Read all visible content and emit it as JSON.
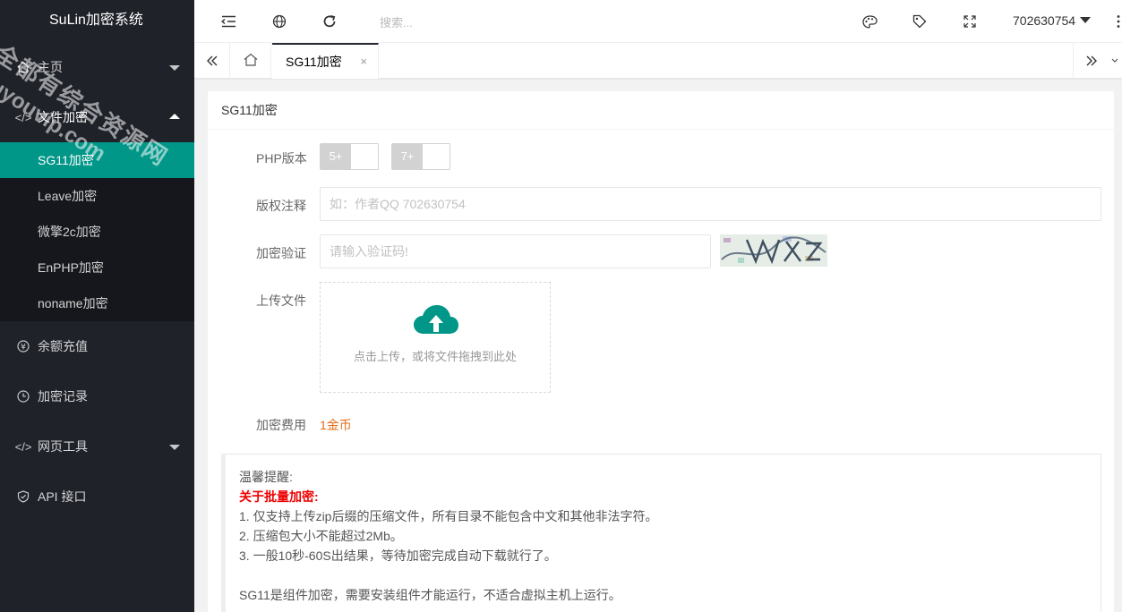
{
  "app": {
    "title": "SuLin加密系统"
  },
  "sidebar": {
    "items": [
      {
        "label": "主页",
        "icon": "home-icon"
      },
      {
        "label": "文件加密",
        "icon": "code-icon"
      },
      {
        "label": "余额充值",
        "icon": "yen-icon"
      },
      {
        "label": "加密记录",
        "icon": "clock-icon"
      },
      {
        "label": "网页工具",
        "icon": "code-icon"
      },
      {
        "label": "API 接口",
        "icon": "shield-icon"
      }
    ],
    "sub_items": [
      "SG11加密",
      "Leave加密",
      "微擎2c加密",
      "EnPHP加密",
      "noname加密"
    ],
    "active_sub": "SG11加密"
  },
  "header": {
    "search_placeholder": "搜索...",
    "username": "702630754"
  },
  "tabs": {
    "active_label": "SG11加密",
    "close": "×"
  },
  "form": {
    "card_title": "SG11加密",
    "php_label": "PHP版本",
    "php_options": [
      "5+",
      "7+"
    ],
    "copyright_label": "版权注释",
    "copyright_placeholder": "如：作者QQ 702630754",
    "captcha_label": "加密验证",
    "captcha_placeholder": "请输入验证码!",
    "upload_label": "上传文件",
    "upload_hint": "点击上传，或将文件拖拽到此处",
    "fee_label": "加密费用",
    "fee_value": "1金币"
  },
  "notice": {
    "heading": "温馨提醒:",
    "batch_title": "关于批量加密:",
    "lines": [
      "1. 仅支持上传zip后缀的压缩文件，所有目录不能包含中文和其他非法字符。",
      "2. 压缩包大小不能超过2Mb。",
      "3. 一般10秒-60S出结果，等待加密完成自动下载就行了。"
    ],
    "footer": "SG11是组件加密，需要安装组件才能运行，不适合虚拟主机上运行。"
  },
  "watermark": {
    "line1": "全都有综合资源网",
    "line2": "douyouvip.com"
  },
  "colors": {
    "sidebar_bg": "#20222a",
    "active": "#009688",
    "fee": "#e26d17",
    "accent_red": "#e00"
  }
}
